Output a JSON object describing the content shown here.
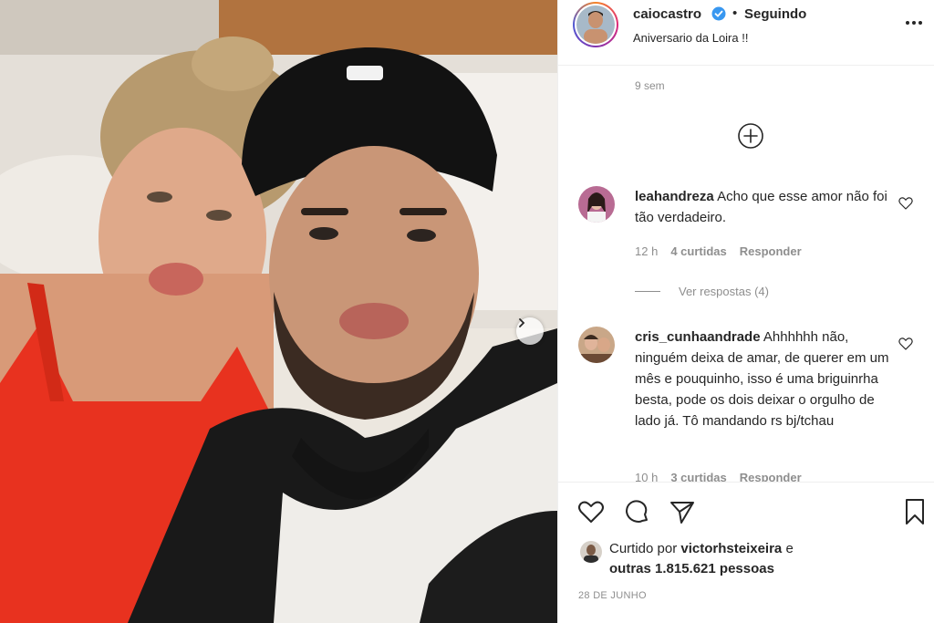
{
  "post": {
    "username": "caiocastro",
    "follow_status": "Seguindo",
    "separator": "•",
    "caption": "Aniversario da Loira !!",
    "time_ago": "9 sem",
    "date": "28 DE JUNHO"
  },
  "comments": [
    {
      "username": "leahandreza",
      "text": "Acho que esse amor não foi tão verdadeiro.",
      "time": "12 h",
      "likes": "4 curtidas",
      "reply_label": "Responder",
      "view_replies": "Ver respostas (4)"
    },
    {
      "username": "cris_cunhaandrade",
      "text": "Ahhhhhh não, ninguém deixa de amar, de querer em um mês e pouquinho, isso é uma briguinrha besta, pode os dois deixar o orgulho de lado já. Tô mandando rs bj/tchau",
      "time": "10 h",
      "likes": "3 curtidas",
      "reply_label": "Responder"
    }
  ],
  "likes": {
    "prefix": "Curtido por",
    "user": "victorhsteixeira",
    "and": "e",
    "others": "outras 1.815.621 pessoas"
  },
  "icons": {
    "more": "more-options-icon",
    "verified": "verified-badge-icon",
    "load_more": "plus-circle-icon",
    "like": "heart-icon",
    "comment": "comment-icon",
    "share": "share-icon",
    "save": "bookmark-icon",
    "next": "chevron-right-icon"
  },
  "colors": {
    "verified_blue": "#3897f0",
    "text": "#262626",
    "muted": "#8e8e8e",
    "border": "#efefef"
  }
}
